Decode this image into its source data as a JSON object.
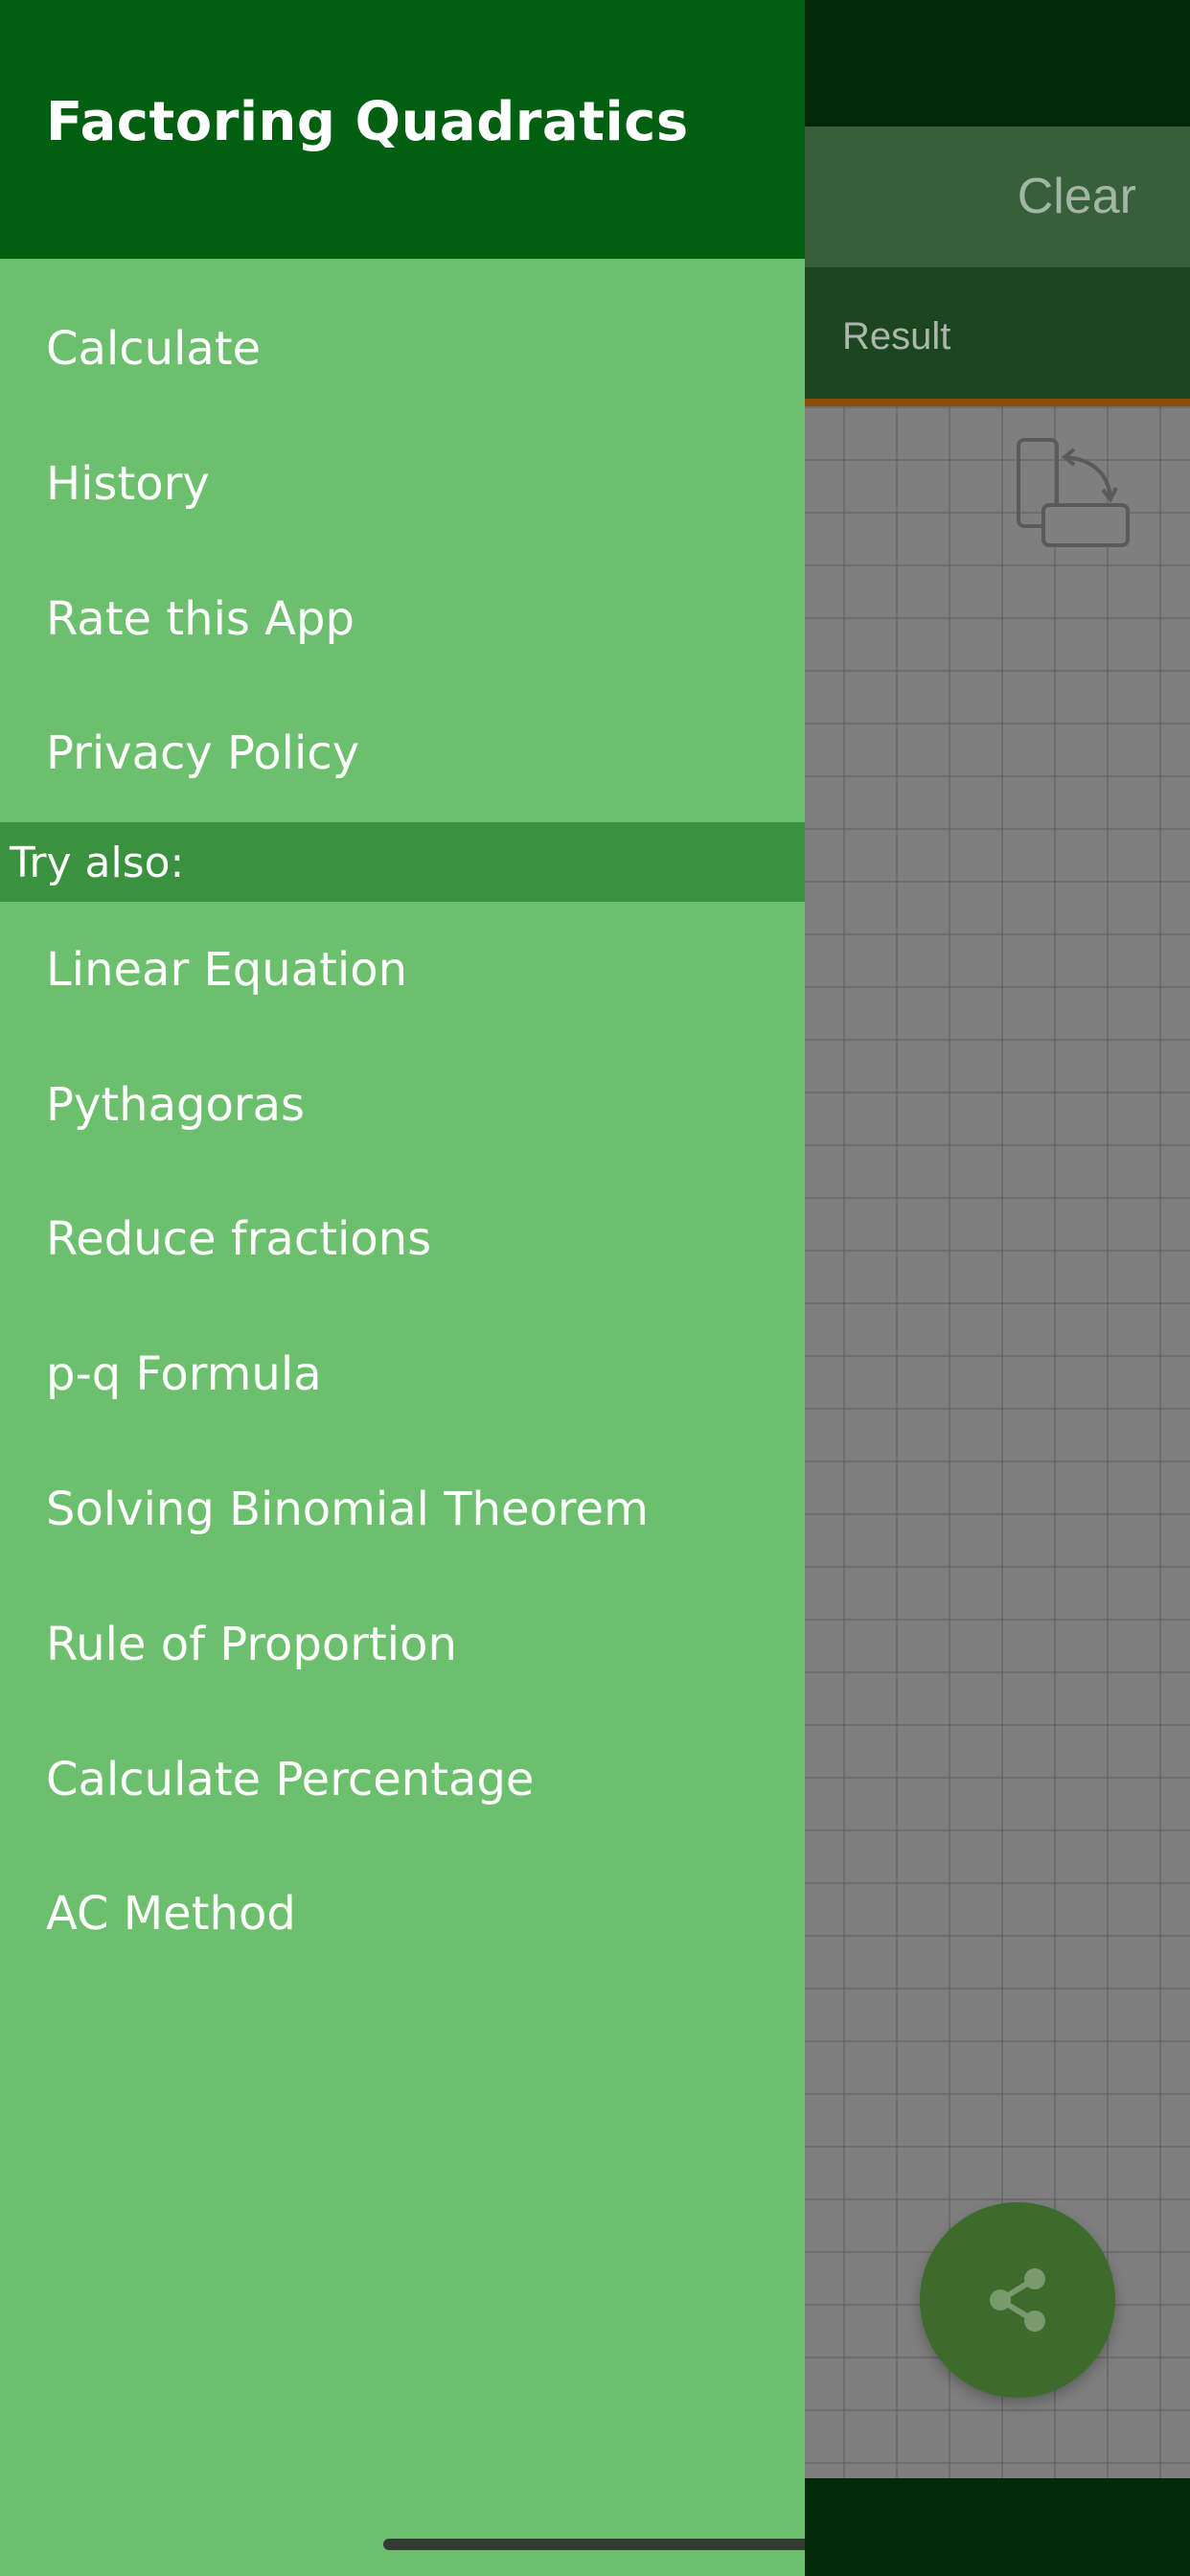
{
  "background": {
    "toolbar": {
      "clear_label": "Clear"
    },
    "tabs": {
      "result_label": "Result"
    },
    "icons": {
      "rotate": "rotate-device-icon",
      "share": "share-icon"
    }
  },
  "drawer": {
    "title": "Factoring Quadratics",
    "items": [
      {
        "label": "Calculate"
      },
      {
        "label": "History"
      },
      {
        "label": "Rate this App"
      },
      {
        "label": "Privacy Policy"
      }
    ],
    "try_also": {
      "header": "Try also:",
      "items": [
        {
          "label": "Linear Equation"
        },
        {
          "label": "Pythagoras"
        },
        {
          "label": "Reduce fractions"
        },
        {
          "label": "p-q Formula"
        },
        {
          "label": "Solving Binomial Theorem"
        },
        {
          "label": "Rule of Proportion"
        },
        {
          "label": "Calculate Percentage"
        },
        {
          "label": "AC Method"
        }
      ]
    }
  },
  "colors": {
    "drawer_bg": "#6cbf6c",
    "drawer_header": "#005f10",
    "section_header": "#3a913e",
    "status_bar": "#002a07"
  }
}
